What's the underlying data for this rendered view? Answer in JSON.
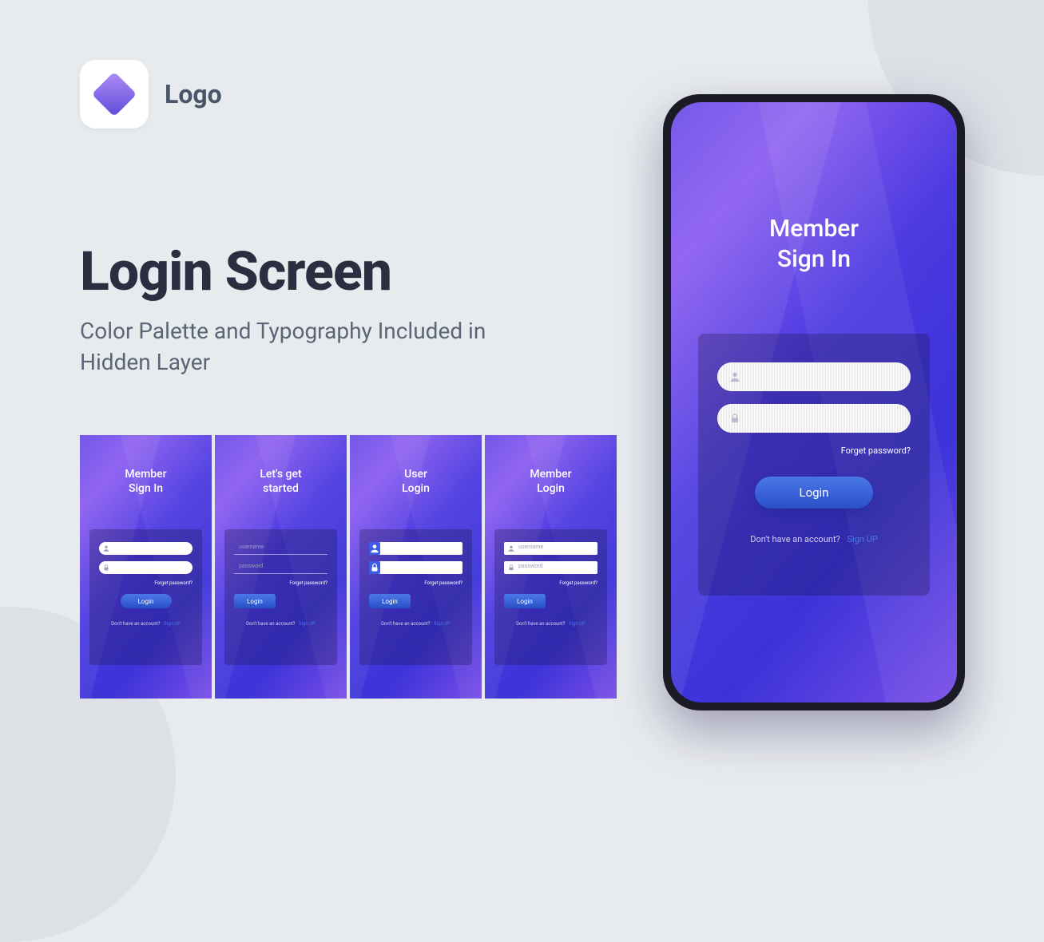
{
  "logo": {
    "text": "Logo"
  },
  "headline": "Login Screen",
  "subhead": "Color Palette and Typography Included in Hidden Layer",
  "thumbs": [
    {
      "title": "Member\nSign In",
      "username_ph": "",
      "password_ph": "",
      "forgot": "Forget password?",
      "login": "Login",
      "signup_prompt": "Don't have an account?",
      "signup": "Sign UP",
      "input_style": "round",
      "has_icons": true,
      "login_align": "center"
    },
    {
      "title": "Let's get\nstarted",
      "username_ph": "username",
      "password_ph": "password",
      "forgot": "Forget password?",
      "login": "Login",
      "signup_prompt": "Don't have an account?",
      "signup": "Sign UP",
      "input_style": "line",
      "has_icons": false,
      "login_align": "left"
    },
    {
      "title": "User\nLogin",
      "username_ph": "",
      "password_ph": "",
      "forgot": "Forget password?",
      "login": "Login",
      "signup_prompt": "Don't have an account?",
      "signup": "Sign UP",
      "input_style": "iconblue",
      "has_icons": true,
      "login_align": "left"
    },
    {
      "title": "Member\nLogin",
      "username_ph": "username",
      "password_ph": "password",
      "forgot": "Forget password?",
      "login": "Login",
      "signup_prompt": "Don't have an account?",
      "signup": "Sign UP",
      "input_style": "rect",
      "has_icons": true,
      "login_align": "left"
    }
  ],
  "phone": {
    "title": "Member\nSign In",
    "forgot": "Forget password?",
    "login": "Login",
    "signup_prompt": "Don't have an account?",
    "signup": "Sign UP"
  }
}
